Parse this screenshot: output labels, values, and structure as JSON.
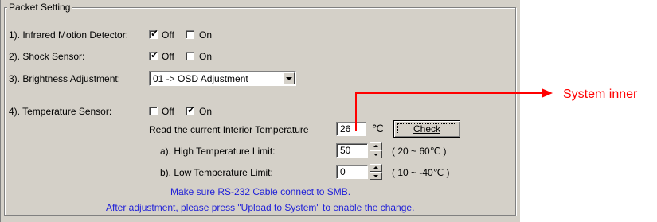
{
  "section": {
    "title": "Packet Setting"
  },
  "rows": {
    "infrared": {
      "label": "1). Infrared Motion Detector:",
      "off_label": "Off",
      "on_label": "On",
      "off_checked": true,
      "on_checked": false
    },
    "shock": {
      "label": "2). Shock Sensor:",
      "off_label": "Off",
      "on_label": "On",
      "off_checked": true,
      "on_checked": false
    },
    "brightness": {
      "label": "3). Brightness Adjustment:",
      "selected": "01 -> OSD Adjustment"
    },
    "temperature": {
      "label": "4). Temperature Sensor:",
      "off_label": "Off",
      "on_label": "On",
      "off_checked": false,
      "on_checked": true
    }
  },
  "temp": {
    "read_label": "Read the current Interior Temperature",
    "current_value": "26",
    "unit": "℃",
    "check_label": "Check",
    "high_label": "a). High Temperature Limit:",
    "high_value": "50",
    "high_range": "( 20 ~ 60℃ )",
    "low_label": "b). Low Temperature Limit:",
    "low_value": "0",
    "low_range": "( 10 ~ -40℃ )"
  },
  "notes": {
    "line1": "Make sure RS-232 Cable connect to SMB.",
    "line2": "After adjustment, please press \"Upload to System\" to enable the change."
  },
  "callout": {
    "text": "System inner"
  },
  "colors": {
    "note": "#2020d8",
    "callout": "#ff0000",
    "panel_bg": "#d4d0c8"
  }
}
